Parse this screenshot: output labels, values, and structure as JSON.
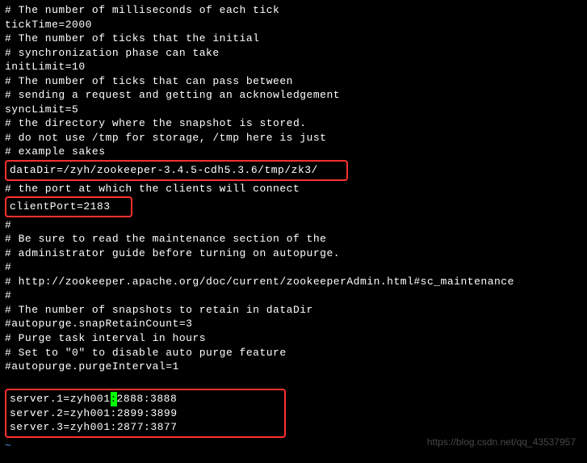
{
  "config": {
    "lines": [
      "# The number of milliseconds of each tick",
      "tickTime=2000",
      "# The number of ticks that the initial",
      "# synchronization phase can take",
      "initLimit=10",
      "# The number of ticks that can pass between",
      "# sending a request and getting an acknowledgement",
      "syncLimit=5",
      "# the directory where the snapshot is stored.",
      "# do not use /tmp for storage, /tmp here is just",
      "# example sakes"
    ],
    "dataDir": "dataDir=/zyh/zookeeper-3.4.5-cdh5.3.6/tmp/zk3/",
    "portComment": "# the port at which the clients will connect",
    "clientPort": "clientPort=2183",
    "lines2": [
      "#",
      "# Be sure to read the maintenance section of the",
      "# administrator guide before turning on autopurge.",
      "#",
      "# http://zookeeper.apache.org/doc/current/zookeeperAdmin.html#sc_maintenance",
      "#",
      "# The number of snapshots to retain in dataDir",
      "#autopurge.snapRetainCount=3",
      "# Purge task interval in hours",
      "# Set to \"0\" to disable auto purge feature",
      "#autopurge.purgeInterval=1",
      ""
    ],
    "server1_pre": "server.1=zyh001",
    "server1_cursor": ":",
    "server1_post": "2888:3888",
    "server2": "server.2=zyh001:2899:3899",
    "server3": "server.3=zyh001:2877:3877"
  },
  "watermark": "https://blog.csdn.net/qq_43537957",
  "tilde": "~"
}
